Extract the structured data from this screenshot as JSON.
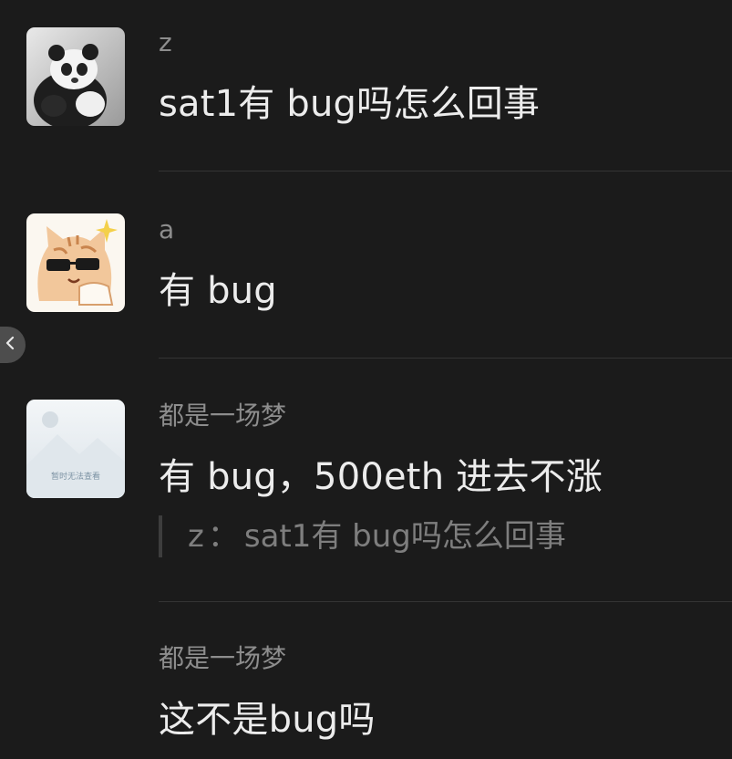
{
  "messages": [
    {
      "sender": "z",
      "text": "sat1有 bug吗怎么回事",
      "avatar": "panda-avatar"
    },
    {
      "sender": "a",
      "text": "有 bug",
      "avatar": "cat-sunglasses-avatar"
    },
    {
      "sender": "都是一场梦",
      "text": "有 bug，500eth 进去不涨",
      "avatar": "image-unavailable-avatar",
      "avatar_label": "暂时无法查看",
      "quote": {
        "author": "z",
        "separator": "：",
        "text": "sat1有 bug吗怎么回事"
      }
    },
    {
      "sender": "都是一场梦",
      "text": "这不是bug吗"
    }
  ],
  "colors": {
    "background": "#1b1b1b",
    "message_text": "#ececec",
    "sender_name": "#8d8d8d",
    "divider": "#343434"
  },
  "icons": {
    "back": "chevron-left-icon"
  }
}
